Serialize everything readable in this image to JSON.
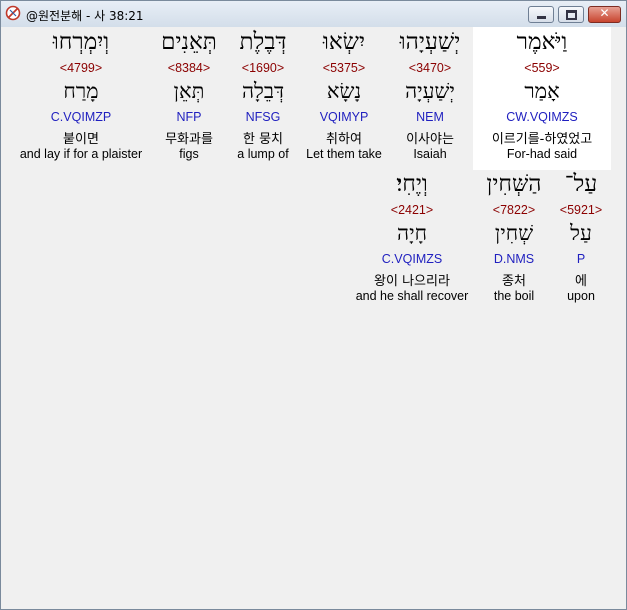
{
  "window": {
    "title": "@원전분해 - 사 38:21"
  },
  "rows": [
    [
      {
        "hebrew": "וַיֹּאמֶר",
        "strong": "<559>",
        "lemma": "אָמַר",
        "parse": "CW.VQIMZS",
        "korean": "이르기를-하였었고",
        "english": "For-had said",
        "highlight": true
      },
      {
        "hebrew": "יְשַׁעְיָהוּ",
        "strong": "<3470>",
        "lemma": "יְשַׁעְיָה",
        "parse": "NEM",
        "korean": "이사야는",
        "english": "Isaiah",
        "highlight": false
      },
      {
        "hebrew": "יִשְׂאוּ",
        "strong": "<5375>",
        "lemma": "נָשָׂא",
        "parse": "VQIMYP",
        "korean": "취하여",
        "english": "Let them take",
        "highlight": false
      },
      {
        "hebrew": "דְּבֶלֶת",
        "strong": "<1690>",
        "lemma": "דְּבֵלָה",
        "parse": "NFSG",
        "korean": "한 뭉치",
        "english": "a lump of",
        "highlight": false
      },
      {
        "hebrew": "תְּאֵנִים",
        "strong": "<8384>",
        "lemma": "תְּאֵן",
        "parse": "NFP",
        "korean": "무화과를",
        "english": "figs",
        "highlight": false
      },
      {
        "hebrew": "וְיִמְרְחוּ",
        "strong": "<4799>",
        "lemma": "מָרַח",
        "parse": "C.VQIMZP",
        "korean": "붙이면",
        "english": "and lay if for a plaister",
        "highlight": false
      }
    ],
    [
      {
        "hebrew": "עַל־",
        "strong": "<5921>",
        "lemma": "עַל",
        "parse": "P",
        "korean": "에",
        "english": "upon",
        "highlight": false
      },
      {
        "hebrew": "הַשְּׁחִין",
        "strong": "<7822>",
        "lemma": "שְׁחִין",
        "parse": "D.NMS",
        "korean": "종처",
        "english": "the boil",
        "highlight": false
      },
      {
        "hebrew": "וְיֶחִי׃",
        "strong": "<2421>",
        "lemma": "חָיָה",
        "parse": "C.VQIMZS",
        "korean": "왕이 나으리라",
        "english": "and he shall recover",
        "highlight": false
      }
    ]
  ]
}
